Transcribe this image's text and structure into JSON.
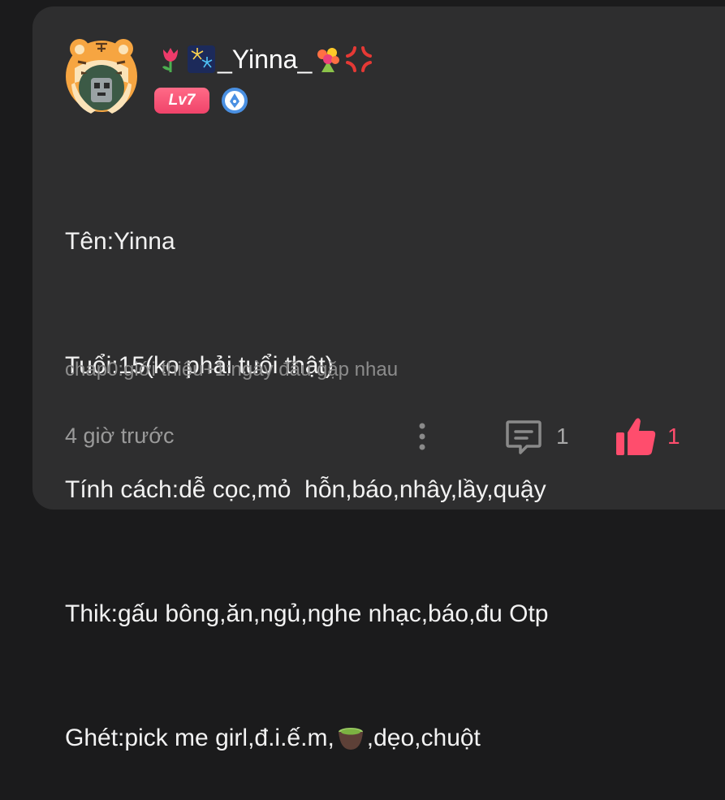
{
  "post": {
    "username": "_Yinna_",
    "level_badge": "Lv7",
    "lines": [
      "Tên:Yinna",
      "Tuổi:15(ko phải tuổi thật)",
      "Tính cách:dễ cọc,mỏ  hỗn,báo,nhây,lầy,quậy",
      "Thik:gấu bông,ăn,ngủ,nghe nhạc,báo,đu Otp"
    ],
    "hate_before": "Ghét:pick me girl,đ.i.ế.m,",
    "hate_after": ",dẹo,chuột",
    "chapter": "chap0:giới thiệu+1:ngày đầu gặp nhau",
    "time": "4 giờ trước",
    "comment_count": "1",
    "like_count": "1"
  },
  "colors": {
    "background": "#1b1b1c",
    "card": "#2e2e2f",
    "like_accent": "#ff4d6d",
    "level_badge": "#f0436a"
  },
  "icons": [
    "tiger-avatar",
    "tulip-icon",
    "fireworks-icon",
    "bouquet-icon",
    "anger-icon",
    "pen-badge-icon",
    "tea-cup-icon",
    "more-vertical-icon",
    "comment-icon",
    "thumbs-up-icon"
  ]
}
